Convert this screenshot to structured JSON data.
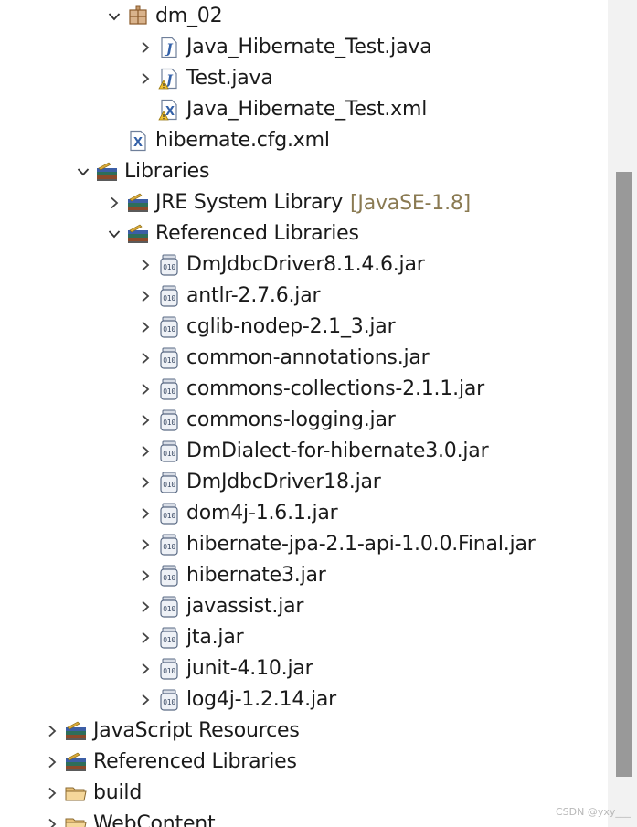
{
  "tree": {
    "rows": [
      {
        "id": "dm02",
        "label": "dm_02",
        "indent": 1,
        "expanded": true,
        "icon": "package-icon"
      },
      {
        "id": "java-hib-test",
        "label": "Java_Hibernate_Test.java",
        "indent": 2,
        "expanded": false,
        "icon": "java-file-icon"
      },
      {
        "id": "test-java",
        "label": "Test.java",
        "indent": 2,
        "expanded": false,
        "icon": "java-file-warning-icon"
      },
      {
        "id": "java-hib-test-xml",
        "label": "Java_Hibernate_Test.xml",
        "indent": 2,
        "leaf": true,
        "icon": "xml-file-warning-icon"
      },
      {
        "id": "hibernate-cfg",
        "label": "hibernate.cfg.xml",
        "indent": 1,
        "leaf": true,
        "icon": "xml-file-icon"
      },
      {
        "id": "libraries",
        "label": "Libraries",
        "indent": 0,
        "expanded": true,
        "icon": "library-icon"
      },
      {
        "id": "jre",
        "label": "JRE System Library",
        "decoration": "[JavaSE-1.8]",
        "indent": 1,
        "expanded": false,
        "icon": "library-icon"
      },
      {
        "id": "ref-libs-inner",
        "label": "Referenced Libraries",
        "indent": 1,
        "expanded": true,
        "icon": "library-icon"
      },
      {
        "id": "jar-dmjdbc8",
        "label": "DmJdbcDriver8.1.4.6.jar",
        "indent": 2,
        "expanded": false,
        "icon": "jar-icon"
      },
      {
        "id": "jar-antlr",
        "label": "antlr-2.7.6.jar",
        "indent": 2,
        "expanded": false,
        "icon": "jar-icon"
      },
      {
        "id": "jar-cglib",
        "label": "cglib-nodep-2.1_3.jar",
        "indent": 2,
        "expanded": false,
        "icon": "jar-icon"
      },
      {
        "id": "jar-common-annotations",
        "label": "common-annotations.jar",
        "indent": 2,
        "expanded": false,
        "icon": "jar-icon"
      },
      {
        "id": "jar-commons-collections",
        "label": "commons-collections-2.1.1.jar",
        "indent": 2,
        "expanded": false,
        "icon": "jar-icon"
      },
      {
        "id": "jar-commons-logging",
        "label": "commons-logging.jar",
        "indent": 2,
        "expanded": false,
        "icon": "jar-icon"
      },
      {
        "id": "jar-dmdialect",
        "label": "DmDialect-for-hibernate3.0.jar",
        "indent": 2,
        "expanded": false,
        "icon": "jar-icon"
      },
      {
        "id": "jar-dmjdbc18",
        "label": "DmJdbcDriver18.jar",
        "indent": 2,
        "expanded": false,
        "icon": "jar-icon"
      },
      {
        "id": "jar-dom4j",
        "label": "dom4j-1.6.1.jar",
        "indent": 2,
        "expanded": false,
        "icon": "jar-icon"
      },
      {
        "id": "jar-hib-jpa",
        "label": "hibernate-jpa-2.1-api-1.0.0.Final.jar",
        "indent": 2,
        "expanded": false,
        "icon": "jar-icon"
      },
      {
        "id": "jar-hibernate3",
        "label": "hibernate3.jar",
        "indent": 2,
        "expanded": false,
        "icon": "jar-icon"
      },
      {
        "id": "jar-javassist",
        "label": "javassist.jar",
        "indent": 2,
        "expanded": false,
        "icon": "jar-icon"
      },
      {
        "id": "jar-jta",
        "label": "jta.jar",
        "indent": 2,
        "expanded": false,
        "icon": "jar-icon"
      },
      {
        "id": "jar-junit",
        "label": "junit-4.10.jar",
        "indent": 2,
        "expanded": false,
        "icon": "jar-icon"
      },
      {
        "id": "jar-log4j",
        "label": "log4j-1.2.14.jar",
        "indent": 2,
        "expanded": false,
        "icon": "jar-icon"
      },
      {
        "id": "js-resources",
        "label": "JavaScript Resources",
        "indent": -1,
        "expanded": false,
        "icon": "library-icon"
      },
      {
        "id": "ref-libs-outer",
        "label": "Referenced Libraries",
        "indent": -1,
        "expanded": false,
        "icon": "library-icon"
      },
      {
        "id": "build",
        "label": "build",
        "indent": -1,
        "expanded": false,
        "icon": "folder-icon"
      },
      {
        "id": "webcontent",
        "label": "WebContent",
        "indent": -1,
        "expanded": false,
        "icon": "folder-icon"
      }
    ]
  },
  "watermark": "CSDN @yxy___",
  "colors": {
    "decoration": "#8a7a52",
    "scroll_thumb": "#999999",
    "scroll_track": "#f2f2f2"
  }
}
